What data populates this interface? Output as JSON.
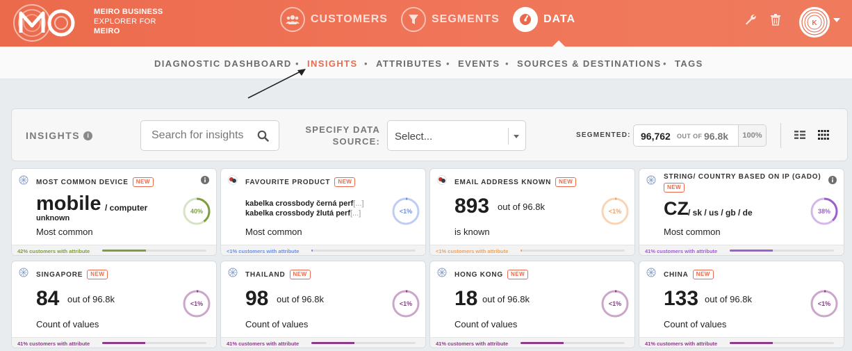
{
  "brand": {
    "line1": "MEIRO BUSINESS",
    "line2": "EXPLORER FOR",
    "line3": "MEIRO",
    "logo_icon": "meiro-logo-icon"
  },
  "main_nav": [
    {
      "label": "CUSTOMERS",
      "icon": "users-icon",
      "active": false
    },
    {
      "label": "SEGMENTS",
      "icon": "funnel-icon",
      "active": false
    },
    {
      "label": "DATA",
      "icon": "gauge-icon",
      "active": true
    }
  ],
  "header_tools": {
    "wrench_icon": "wrench-icon",
    "trash_icon": "trash-icon",
    "avatar_initial": "K"
  },
  "sub_nav": [
    {
      "label": "DIAGNOSTIC DASHBOARD",
      "active": false
    },
    {
      "label": "INSIGHTS",
      "active": true
    },
    {
      "label": "ATTRIBUTES",
      "active": false
    },
    {
      "label": "EVENTS",
      "active": false
    },
    {
      "label": "SOURCES & DESTINATIONS",
      "active": false
    },
    {
      "label": "TAGS",
      "active": false
    }
  ],
  "sub_nav_separator": "•",
  "insights_panel": {
    "title": "INSIGHTS",
    "info_glyph": "i",
    "search_placeholder": "Search for insights",
    "specify_label_line1": "SPECIFY DATA",
    "specify_label_line2": "SOURCE:",
    "source_select_value": "Select...",
    "segmented_label": "SEGMENTED:",
    "segmented_count": "96,762",
    "segmented_out_of": "OUT OF",
    "segmented_total": "96.8k",
    "segmented_percent": "100%"
  },
  "badge_new": "NEW",
  "colors": {
    "accent": "#ec6a4c",
    "green": "#7e9e3e",
    "blue": "#6d8ee0",
    "orange": "#f0a25a",
    "purple": "#9a5fd0",
    "plum": "#8e3a8a"
  },
  "tiles": [
    {
      "name": "MOST COMMON DEVICE",
      "has_info": true,
      "value": "mobile",
      "alt": "/ computer",
      "alt2": "unknown",
      "label": "Most common",
      "ring": "40%",
      "ring_fraction": 0.42,
      "color": "#7e9e3e",
      "foot": "42% customers with attribute"
    },
    {
      "name": "FAVOURITE PRODUCT",
      "has_info": false,
      "line1": "kabelka crossbody černá perf",
      "line2": "kabelka crossbody žlutá perf",
      "trunc": "[...]",
      "label": "Most common",
      "ring": "<1%",
      "ring_fraction": 0.01,
      "color": "#6d8ee0",
      "foot": "<1% customers with attribute"
    },
    {
      "name": "EMAIL ADDRESS KNOWN",
      "has_info": false,
      "value": "893",
      "of": "out of 96.8k",
      "label": "is known",
      "ring": "<1%",
      "ring_fraction": 0.01,
      "color": "#f0a25a",
      "foot": "<1% customers with attribute"
    },
    {
      "name": "STRING/ COUNTRY BASED ON IP (GADO)",
      "has_info": true,
      "value": "CZ",
      "alt": "/ sk / us / gb / de",
      "label": "Most common",
      "ring": "38%",
      "ring_fraction": 0.41,
      "color": "#9a5fd0",
      "foot": "41% customers with attribute"
    },
    {
      "name": "SINGAPORE",
      "has_info": false,
      "value": "84",
      "of": "out of 96.8k",
      "label": "Count of values",
      "ring": "<1%",
      "ring_fraction": 0.41,
      "color": "#8e3a8a",
      "foot": "41% customers with attribute"
    },
    {
      "name": "THAILAND",
      "has_info": false,
      "value": "98",
      "of": "out of 96.8k",
      "label": "Count of values",
      "ring": "<1%",
      "ring_fraction": 0.41,
      "color": "#8e3a8a",
      "foot": "41% customers with attribute"
    },
    {
      "name": "HONG KONG",
      "has_info": false,
      "value": "18",
      "of": "out of 96.8k",
      "label": "Count of values",
      "ring": "<1%",
      "ring_fraction": 0.41,
      "color": "#8e3a8a",
      "foot": "41% customers with attribute"
    },
    {
      "name": "CHINA",
      "has_info": false,
      "value": "133",
      "of": "out of 96.8k",
      "label": "Count of values",
      "ring": "<1%",
      "ring_fraction": 0.41,
      "color": "#8e3a8a",
      "foot": "41% customers with attribute"
    }
  ]
}
